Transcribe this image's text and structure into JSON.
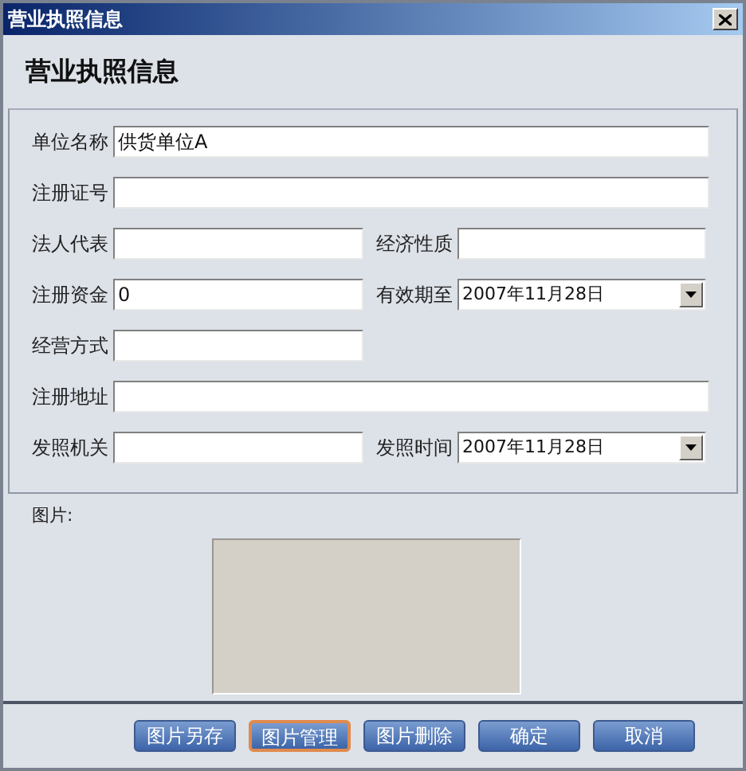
{
  "window": {
    "title": "营业执照信息"
  },
  "heading": "营业执照信息",
  "rows": [
    [
      {
        "label": "单位名称",
        "kind": "text",
        "value": "供货单位A",
        "wide": true
      }
    ],
    [
      {
        "label": "注册证号",
        "kind": "text",
        "wide": true
      }
    ],
    [
      {
        "label": "法人代表",
        "kind": "text"
      },
      {
        "label": "经济性质",
        "kind": "text"
      }
    ],
    [
      {
        "label": "注册资金",
        "kind": "text",
        "value": "0"
      },
      {
        "label": "有效期至",
        "kind": "date",
        "value": "2007年11月28日"
      }
    ],
    [
      {
        "label": "经营方式",
        "kind": "text"
      }
    ],
    [
      {
        "label": "注册地址",
        "kind": "text",
        "wide": true
      }
    ],
    [
      {
        "label": "发照机关",
        "kind": "text"
      },
      {
        "label": "发照时间",
        "kind": "date",
        "value": "2007年11月28日"
      }
    ]
  ],
  "picture_label": "图片:",
  "buttons": [
    {
      "label": "图片另存",
      "focused": false
    },
    {
      "label": "图片管理",
      "focused": true
    },
    {
      "label": "图片删除",
      "focused": false
    },
    {
      "label": "确定",
      "focused": false
    },
    {
      "label": "取消",
      "focused": false
    }
  ]
}
